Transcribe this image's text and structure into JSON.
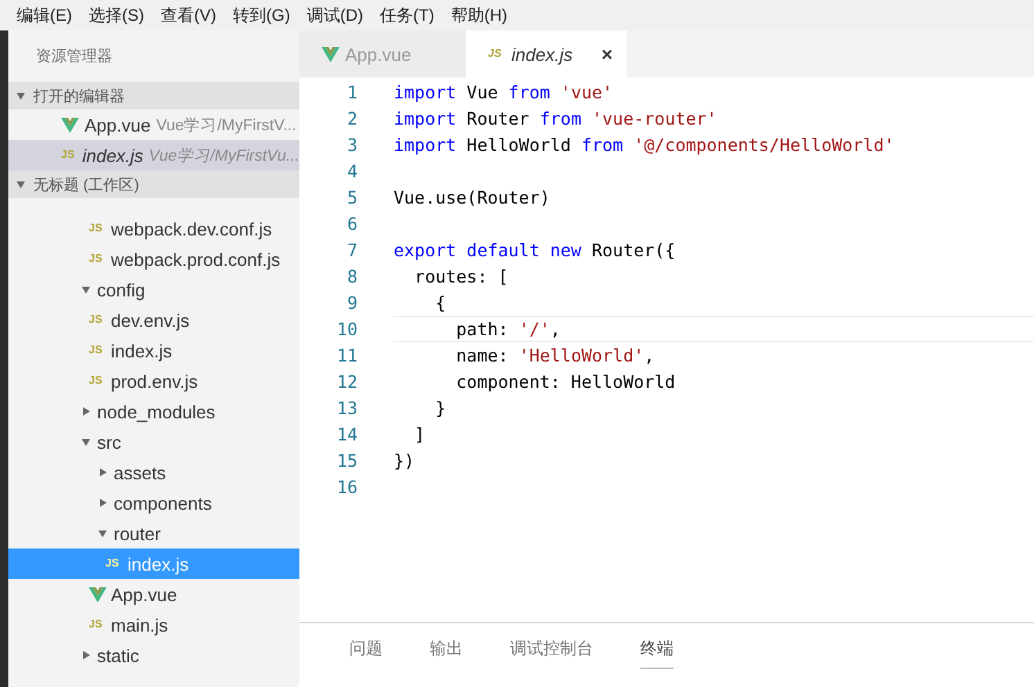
{
  "menu_bar": [
    "编辑(E)",
    "选择(S)",
    "查看(V)",
    "转到(G)",
    "调试(D)",
    "任务(T)",
    "帮助(H)"
  ],
  "sidebar": {
    "title": "资源管理器",
    "open_editors": {
      "header": "打开的编辑器",
      "expanded": true,
      "items": [
        {
          "name": "App.vue",
          "path": "Vue学习/MyFirstV...",
          "kind": "vue",
          "selected": false
        },
        {
          "name": "index.js",
          "path": "Vue学习/MyFirstVu...",
          "kind": "js",
          "badge": "JS",
          "selected": true
        }
      ]
    },
    "workspace": {
      "header": "无标题 (工作区)",
      "expanded": true,
      "scrolled_children": [
        {
          "name": "webpack.dev.conf.js",
          "kind": "js",
          "badge": "JS",
          "selected": false
        },
        {
          "name": "webpack.prod.conf.js",
          "kind": "js",
          "badge": "JS",
          "selected": false
        }
      ],
      "tree": [
        {
          "name": "config",
          "kind": "folder",
          "expanded": true,
          "selected": false,
          "children": [
            {
              "name": "dev.env.js",
              "kind": "js",
              "badge": "JS",
              "selected": false
            },
            {
              "name": "index.js",
              "kind": "js",
              "badge": "JS",
              "selected": false
            },
            {
              "name": "prod.env.js",
              "kind": "js",
              "badge": "JS",
              "selected": false
            }
          ]
        },
        {
          "name": "node_modules",
          "kind": "folder",
          "expanded": false,
          "selected": false
        },
        {
          "name": "src",
          "kind": "folder",
          "expanded": true,
          "selected": false,
          "children": [
            {
              "name": "assets",
              "kind": "folder",
              "expanded": false,
              "selected": false
            },
            {
              "name": "components",
              "kind": "folder",
              "expanded": false,
              "selected": false
            },
            {
              "name": "router",
              "kind": "folder",
              "expanded": true,
              "selected": false,
              "children": [
                {
                  "name": "index.js",
                  "kind": "js",
                  "badge": "JS",
                  "selected": true
                }
              ]
            },
            {
              "name": "App.vue",
              "kind": "vue",
              "selected": false
            },
            {
              "name": "main.js",
              "kind": "js",
              "badge": "JS",
              "selected": false
            }
          ]
        },
        {
          "name": "static",
          "kind": "folder",
          "expanded": false,
          "selected": false
        }
      ]
    }
  },
  "editor_tabs": [
    {
      "label": "App.vue",
      "kind": "vue",
      "selected": false
    },
    {
      "label": "index.js",
      "kind": "js",
      "badge": "JS",
      "selected": true,
      "close": "×"
    }
  ],
  "code": [
    {
      "number": "1",
      "current": false,
      "tokens": [
        {
          "kind": "kw",
          "text": "import"
        },
        {
          "kind": "plain",
          "text": " Vue "
        },
        {
          "kind": "kw",
          "text": "from"
        },
        {
          "kind": "str",
          "text": " 'vue'"
        }
      ]
    },
    {
      "number": "2",
      "current": false,
      "tokens": [
        {
          "kind": "kw",
          "text": "import"
        },
        {
          "kind": "plain",
          "text": " Router "
        },
        {
          "kind": "kw",
          "text": "from"
        },
        {
          "kind": "str",
          "text": " 'vue-router'"
        }
      ]
    },
    {
      "number": "3",
      "current": false,
      "tokens": [
        {
          "kind": "kw",
          "text": "import"
        },
        {
          "kind": "plain",
          "text": " HelloWorld "
        },
        {
          "kind": "kw",
          "text": "from"
        },
        {
          "kind": "str",
          "text": " '@/components/HelloWorld'"
        }
      ]
    },
    {
      "number": "4",
      "current": false
    },
    {
      "number": "5",
      "current": false,
      "tokens": [
        {
          "kind": "plain",
          "text": "Vue.use(Router)"
        }
      ]
    },
    {
      "number": "6",
      "current": false
    },
    {
      "number": "7",
      "current": false,
      "tokens": [
        {
          "kind": "kw",
          "text": "export default new"
        },
        {
          "kind": "plain",
          "text": " Router({"
        }
      ]
    },
    {
      "number": "8",
      "current": false,
      "tokens": [
        {
          "kind": "plain",
          "text": "  routes: ["
        }
      ]
    },
    {
      "number": "9",
      "current": false,
      "tokens": [
        {
          "kind": "plain",
          "text": "    {"
        }
      ]
    },
    {
      "number": "10",
      "current": true,
      "tokens": [
        {
          "kind": "plain",
          "text": "      path: "
        },
        {
          "kind": "str",
          "text": "'/'"
        },
        {
          "kind": "plain",
          "text": ","
        }
      ]
    },
    {
      "number": "11",
      "current": false,
      "tokens": [
        {
          "kind": "plain",
          "text": "      name: "
        },
        {
          "kind": "str",
          "text": "'HelloWorld'"
        },
        {
          "kind": "plain",
          "text": ","
        }
      ]
    },
    {
      "number": "12",
      "current": false,
      "tokens": [
        {
          "kind": "plain",
          "text": "      component: HelloWorld"
        }
      ]
    },
    {
      "number": "13",
      "current": false,
      "tokens": [
        {
          "kind": "plain",
          "text": "    }"
        }
      ]
    },
    {
      "number": "14",
      "current": false,
      "tokens": [
        {
          "kind": "plain",
          "text": "  ]"
        }
      ]
    },
    {
      "number": "15",
      "current": false,
      "tokens": [
        {
          "kind": "plain",
          "text": "})"
        }
      ]
    },
    {
      "number": "16",
      "current": false
    }
  ],
  "panel_tabs": [
    {
      "label": "问题",
      "selected": false
    },
    {
      "label": "输出",
      "selected": false
    },
    {
      "label": "调试控制台",
      "selected": false
    },
    {
      "label": "终端",
      "selected": true
    }
  ]
}
